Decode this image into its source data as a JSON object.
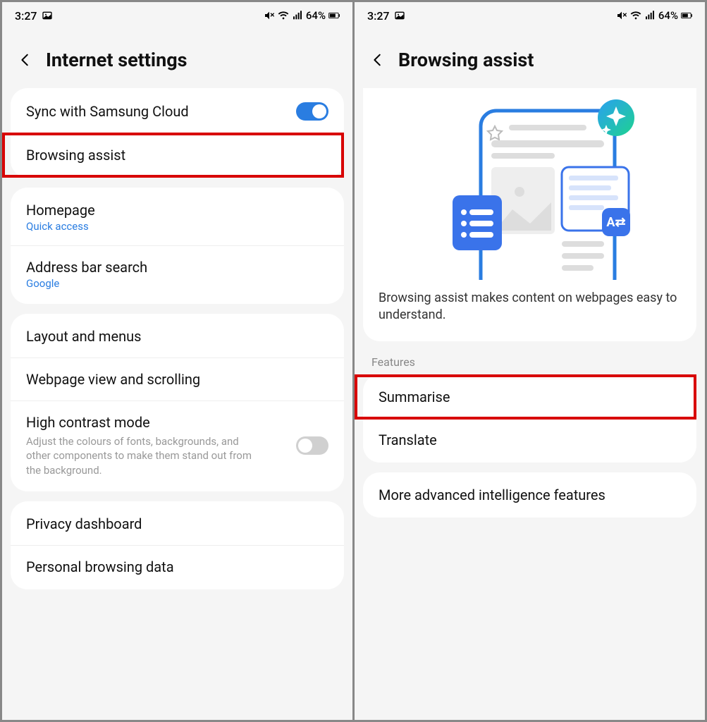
{
  "status": {
    "time": "3:27",
    "battery_pct": "64%"
  },
  "left": {
    "title": "Internet settings",
    "sync": {
      "label": "Sync with Samsung Cloud"
    },
    "browsing_assist": {
      "label": "Browsing assist"
    },
    "homepage": {
      "label": "Homepage",
      "sub": "Quick access"
    },
    "address_bar": {
      "label": "Address bar search",
      "sub": "Google"
    },
    "layout_menus": {
      "label": "Layout and menus"
    },
    "webpage_view": {
      "label": "Webpage view and scrolling"
    },
    "high_contrast": {
      "label": "High contrast mode",
      "desc": "Adjust the colours of fonts, backgrounds, and other components to make them stand out from the background."
    },
    "privacy_dashboard": {
      "label": "Privacy dashboard"
    },
    "personal_browsing": {
      "label": "Personal browsing data"
    }
  },
  "right": {
    "title": "Browsing assist",
    "desc": "Browsing assist makes content on webpages easy to understand.",
    "features_label": "Features",
    "summarise": {
      "label": "Summarise"
    },
    "translate": {
      "label": "Translate"
    },
    "more_features": {
      "label": "More advanced intelligence features"
    }
  }
}
